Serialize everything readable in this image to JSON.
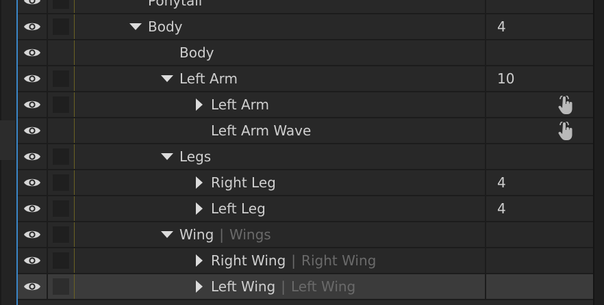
{
  "layers": [
    {
      "name": "Ponytail",
      "alias": "",
      "value": "",
      "twirl": "none",
      "indent": 0,
      "checkbox": true,
      "pick_whip": false,
      "selected": false
    },
    {
      "name": "Body",
      "alias": "",
      "value": "4",
      "twirl": "down",
      "indent": 0,
      "checkbox": true,
      "pick_whip": false,
      "selected": false
    },
    {
      "name": "Body",
      "alias": "",
      "value": "",
      "twirl": "none",
      "indent": 1,
      "checkbox": false,
      "pick_whip": false,
      "selected": false
    },
    {
      "name": "Left Arm",
      "alias": "",
      "value": "10",
      "twirl": "down",
      "indent": 1,
      "checkbox": true,
      "pick_whip": false,
      "selected": false
    },
    {
      "name": "Left Arm",
      "alias": "",
      "value": "",
      "twirl": "right",
      "indent": 2,
      "checkbox": true,
      "pick_whip": true,
      "selected": false
    },
    {
      "name": "Left Arm Wave",
      "alias": "",
      "value": "",
      "twirl": "none",
      "indent": 2,
      "checkbox": false,
      "pick_whip": true,
      "selected": false
    },
    {
      "name": "Legs",
      "alias": "",
      "value": "",
      "twirl": "down",
      "indent": 1,
      "checkbox": true,
      "pick_whip": false,
      "selected": false
    },
    {
      "name": "Right Leg",
      "alias": "",
      "value": "4",
      "twirl": "right",
      "indent": 2,
      "checkbox": true,
      "pick_whip": false,
      "selected": false
    },
    {
      "name": "Left Leg",
      "alias": "",
      "value": "4",
      "twirl": "right",
      "indent": 2,
      "checkbox": true,
      "pick_whip": false,
      "selected": false
    },
    {
      "name": "Wing",
      "alias": "Wings",
      "value": "",
      "twirl": "down",
      "indent": 1,
      "checkbox": true,
      "pick_whip": false,
      "selected": false
    },
    {
      "name": "Right Wing",
      "alias": "Right Wing",
      "value": "",
      "twirl": "right",
      "indent": 2,
      "checkbox": true,
      "pick_whip": false,
      "selected": false
    },
    {
      "name": "Left Wing",
      "alias": "Left Wing",
      "value": "",
      "twirl": "right",
      "indent": 2,
      "checkbox": true,
      "pick_whip": false,
      "selected": true
    }
  ],
  "separator": "|",
  "icons": {
    "visibility": "eye-icon",
    "expanded": "triangle-down-icon",
    "collapsed": "triangle-right-icon",
    "pick_whip": "hand-pointer-icon"
  },
  "colors": {
    "text": "#cfcfcf",
    "alias_text": "#6a6a6a",
    "accent_line": "#3a86c8",
    "label_divider": "#6b6223"
  }
}
